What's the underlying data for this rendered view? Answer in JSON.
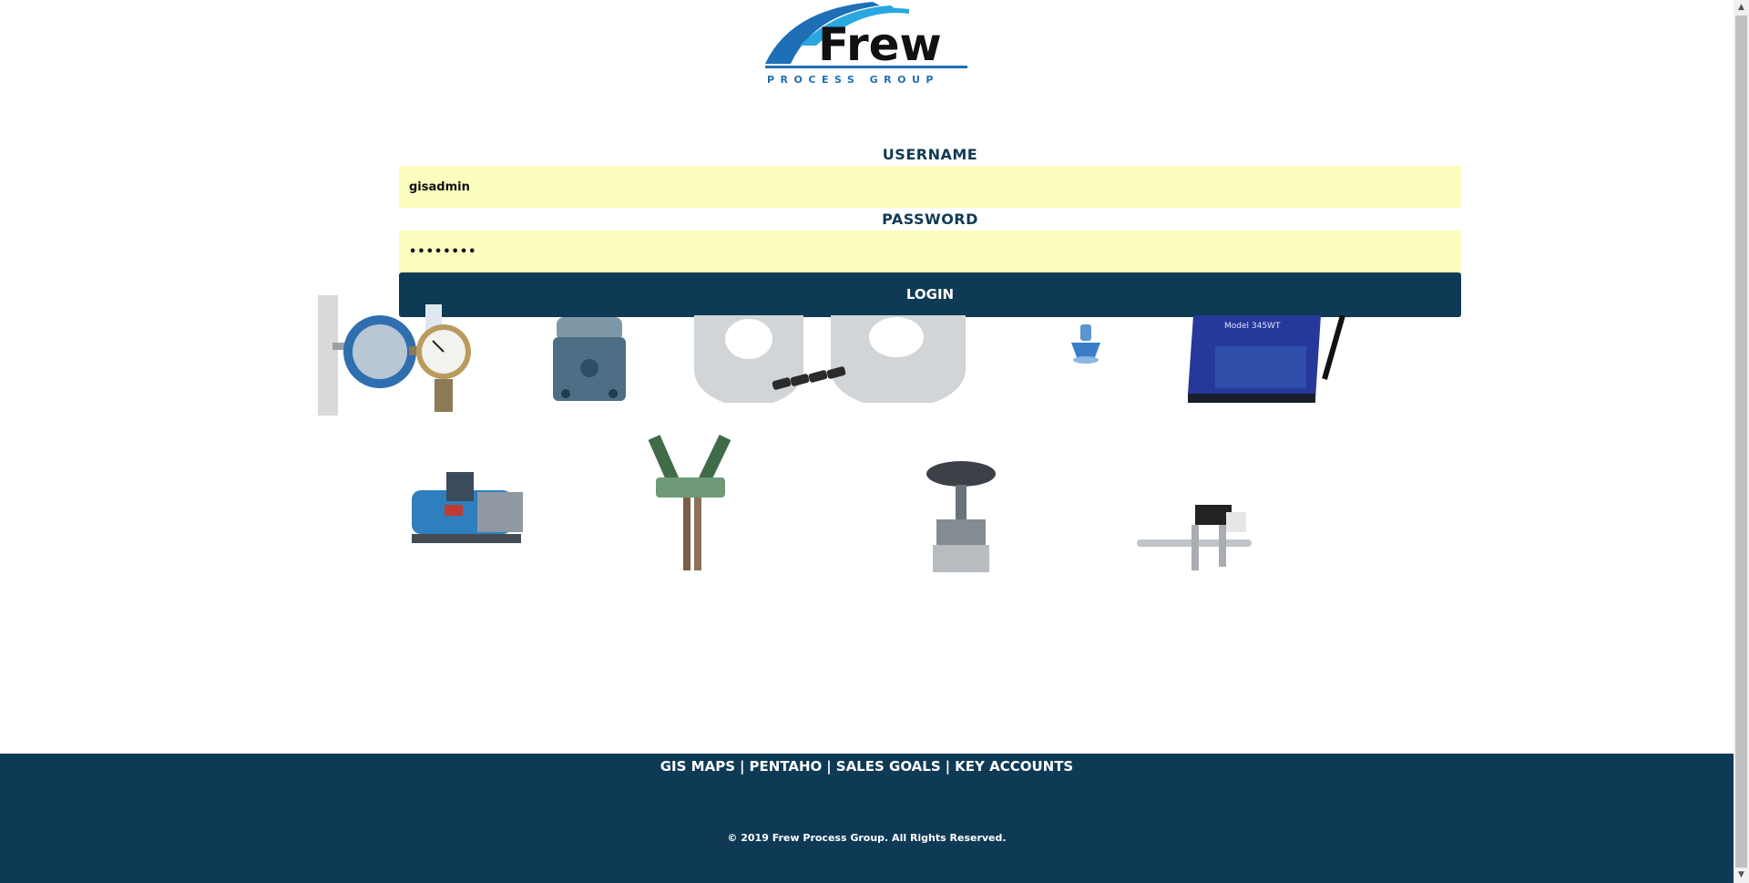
{
  "logo": {
    "brand": "Frew",
    "tagline": "PROCESS GROUP"
  },
  "form": {
    "username_label": "USERNAME",
    "username_value": "gisadmin",
    "password_label": "PASSWORD",
    "password_value": "gisadmin",
    "login_label": "LOGIN"
  },
  "products": [
    "gauge-assembly",
    "regulator",
    "flange-kit",
    "blue-fitting",
    "model-345wt-logger",
    "boiler",
    "y-valve",
    "control-valve",
    "piping-assembly"
  ],
  "footer": {
    "links": [
      {
        "label": "GIS MAPS"
      },
      {
        "label": "PENTAHO"
      },
      {
        "label": "SALES GOALS"
      },
      {
        "label": "KEY ACCOUNTS"
      }
    ],
    "separator": "|",
    "copyright": "© 2019 Frew Process Group. All Rights Reserved."
  },
  "colors": {
    "navy": "#0f3a55",
    "input_bg": "#fbfdbe",
    "logo_blue": "#1e6fb5",
    "logo_light_blue": "#29a8e0"
  }
}
